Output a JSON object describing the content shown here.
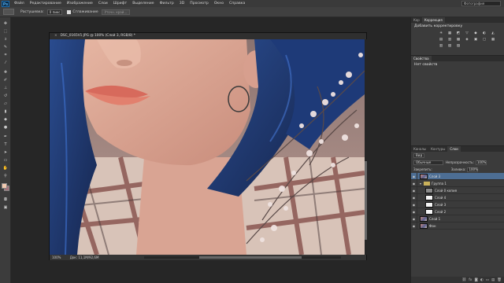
{
  "app": {
    "logo": "Ps"
  },
  "menu": [
    "Файл",
    "Редактирование",
    "Изображение",
    "Слои",
    "Шрифт",
    "Выделение",
    "Фильтр",
    "3D",
    "Просмотр",
    "Окно",
    "Справка"
  ],
  "workspace": "Фотография",
  "options": {
    "feather_label": "Растушевка:",
    "feather_value": "0 пикс",
    "smoothing_label": "Сглаживание",
    "refine_button": "Уточн. край..."
  },
  "document": {
    "tab_title": "DSC_0165V1.JPG @ 100% (Слой 3, RGB/8) *",
    "close_glyph": "×",
    "zoom": "100%",
    "doc_size": "Док: 11,1M/92,6M"
  },
  "panels": {
    "adjust_tabs": [
      "Кор",
      "Коррекция"
    ],
    "adjust_title": "Добавить корректировку",
    "adjust_icons": [
      "☀",
      "▦",
      "◩",
      "▽",
      "◆",
      "◐",
      "◭",
      "▤",
      "▥",
      "▩",
      "◈",
      "▣",
      "▢",
      "▦",
      "▥",
      "▧",
      "▨"
    ],
    "props_title": "Свойства",
    "props_text": "Нет свойств",
    "layers_tabs": [
      "Каналы",
      "Контуры",
      "Слои"
    ],
    "kind_label": "Вид",
    "blend_mode": "Обычные",
    "opacity_label": "Непрозрачность:",
    "opacity_value": "100%",
    "lock_label": "Закрепить:",
    "fill_label": "Заливка:",
    "fill_value": "100%",
    "layers": [
      {
        "name": "Слой 3",
        "thumb": "photo",
        "selected": true
      },
      {
        "name": "Группа 1",
        "thumb": "folder",
        "selected": false
      },
      {
        "name": "Слой 0 копия",
        "thumb": "gray",
        "selected": false
      },
      {
        "name": "Слой 4",
        "thumb": "white",
        "selected": false
      },
      {
        "name": "Слой 3",
        "thumb": "white",
        "selected": false
      },
      {
        "name": "Слой 2",
        "thumb": "white",
        "selected": false
      },
      {
        "name": "Слой 1",
        "thumb": "photo",
        "selected": false
      },
      {
        "name": "Фон",
        "thumb": "photo",
        "selected": false
      }
    ],
    "eye_glyph": "◉",
    "layer_tools": [
      "⛓",
      "fx",
      "◙",
      "◐",
      "▭",
      "▤",
      "🗑"
    ]
  }
}
